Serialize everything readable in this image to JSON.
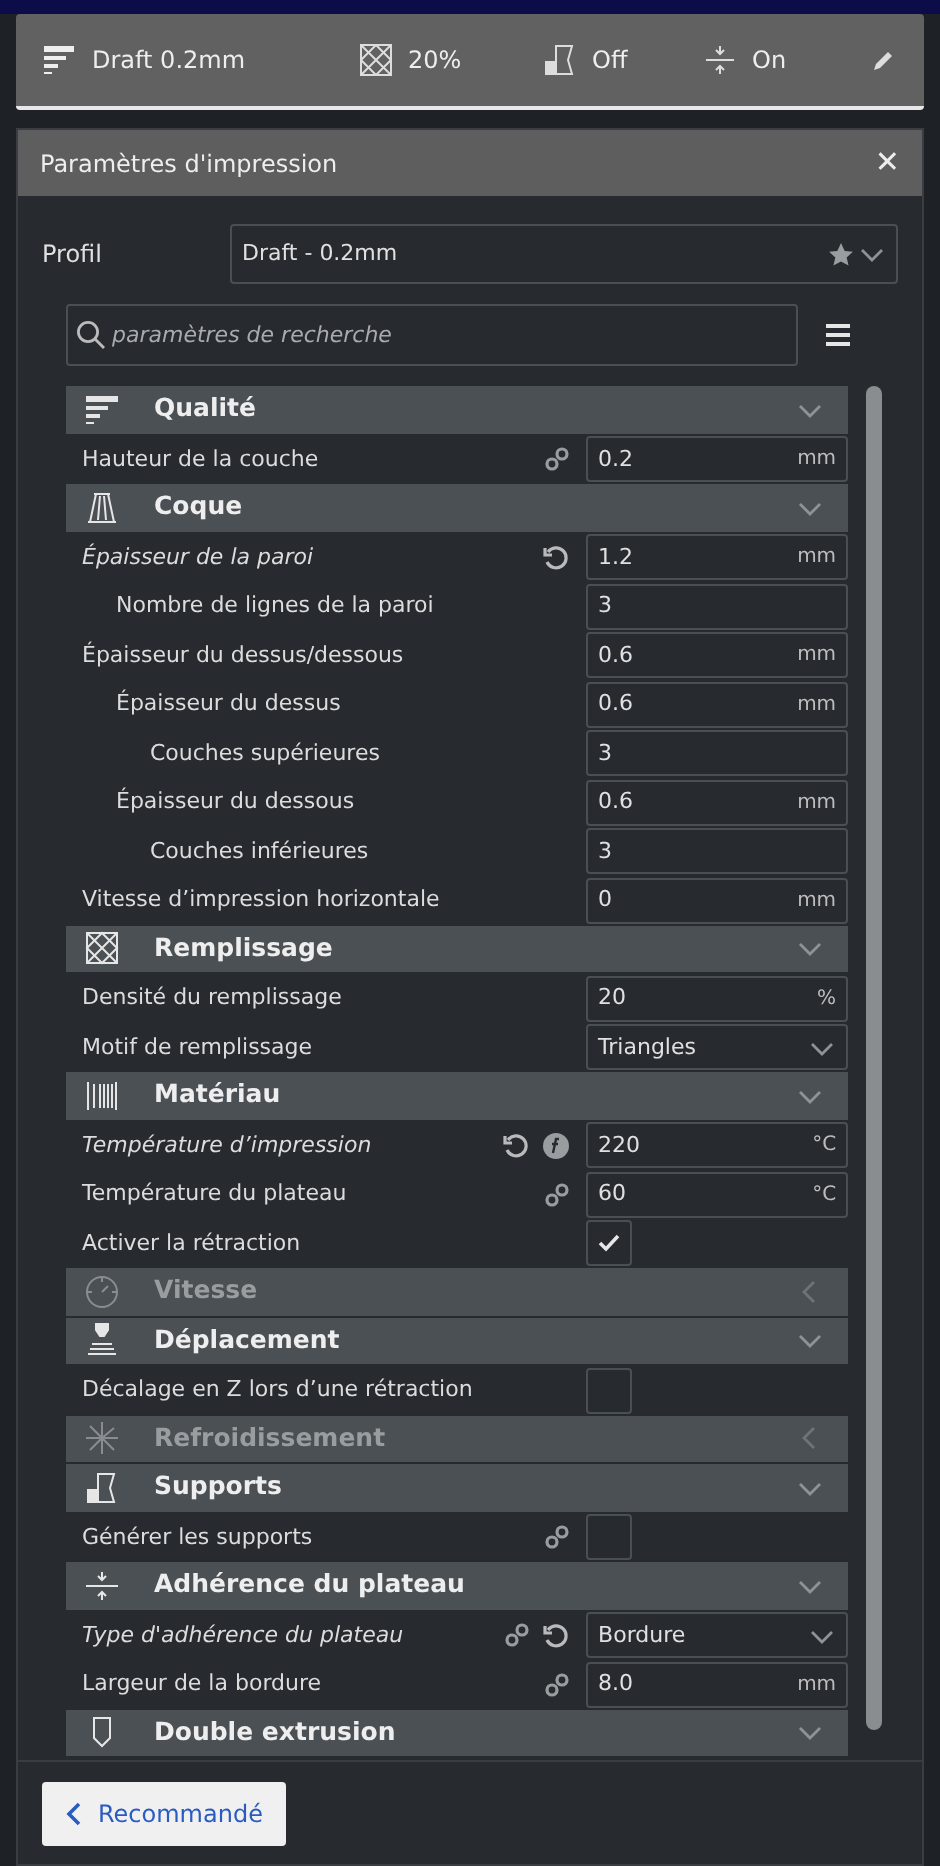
{
  "summary_bar": {
    "profile": "Draft 0.2mm",
    "infill": "20%",
    "support": "Off",
    "adhesion": "On"
  },
  "panel": {
    "title": "Paramètres d'impression",
    "close": "✕"
  },
  "profile": {
    "label": "Profil",
    "value": "Draft - 0.2mm"
  },
  "search": {
    "placeholder": "paramètres de recherche"
  },
  "sections": [
    {
      "kind": "quality",
      "title": "Qualité",
      "expanded": true,
      "settings": [
        {
          "label": "Hauteur de la couche",
          "kind": "number",
          "value": "0.2",
          "unit": "mm",
          "modified": false,
          "linked": true,
          "resettable": false,
          "formula": false
        }
      ]
    },
    {
      "kind": "shell",
      "title": "Coque",
      "expanded": true,
      "settings": [
        {
          "label": "Épaisseur de la paroi",
          "kind": "number",
          "value": "1.2",
          "unit": "mm",
          "modified": true,
          "linked": false,
          "resettable": true,
          "formula": false,
          "children": [
            {
              "label": "Nombre de lignes de la paroi",
              "kind": "number",
              "value": "3",
              "modified": false,
              "linked": false,
              "resettable": false,
              "formula": false
            }
          ]
        },
        {
          "label": "Épaisseur du dessus/dessous",
          "kind": "number",
          "value": "0.6",
          "unit": "mm",
          "modified": false,
          "linked": false,
          "resettable": false,
          "formula": false,
          "children": [
            {
              "label": "Épaisseur du dessus",
              "kind": "number",
              "value": "0.6",
              "unit": "mm",
              "modified": false,
              "linked": false,
              "resettable": false,
              "formula": false,
              "children": [
                {
                  "label": "Couches supérieures",
                  "kind": "number",
                  "value": "3",
                  "modified": false,
                  "linked": false,
                  "resettable": false,
                  "formula": false
                }
              ]
            },
            {
              "label": "Épaisseur du dessous",
              "kind": "number",
              "value": "0.6",
              "unit": "mm",
              "modified": false,
              "linked": false,
              "resettable": false,
              "formula": false,
              "children": [
                {
                  "label": "Couches inférieures",
                  "kind": "number",
                  "value": "3",
                  "modified": false,
                  "linked": false,
                  "resettable": false,
                  "formula": false
                }
              ]
            }
          ]
        },
        {
          "label": "Vitesse d’impression horizontale",
          "kind": "number",
          "value": "0",
          "unit": "mm",
          "modified": false,
          "linked": false,
          "resettable": false,
          "formula": false
        }
      ]
    },
    {
      "kind": "infill",
      "title": "Remplissage",
      "expanded": true,
      "settings": [
        {
          "label": "Densité du remplissage",
          "kind": "number",
          "value": "20",
          "unit": "%",
          "modified": false,
          "linked": false,
          "resettable": false,
          "formula": false
        },
        {
          "label": "Motif de remplissage",
          "kind": "select",
          "value": "Triangles",
          "modified": false,
          "linked": false,
          "resettable": false,
          "formula": false
        }
      ]
    },
    {
      "kind": "material",
      "title": "Matériau",
      "expanded": true,
      "settings": [
        {
          "label": "Température d’impression",
          "kind": "number",
          "value": "220",
          "unit": "°C",
          "modified": true,
          "linked": false,
          "resettable": true,
          "formula": true
        },
        {
          "label": "Température du plateau",
          "kind": "number",
          "value": "60",
          "unit": "°C",
          "modified": false,
          "linked": true,
          "resettable": false,
          "formula": false
        },
        {
          "label": "Activer la rétraction",
          "kind": "checkbox",
          "checked": true,
          "modified": false,
          "linked": false,
          "resettable": false,
          "formula": false
        }
      ]
    },
    {
      "kind": "speed",
      "title": "Vitesse",
      "expanded": false
    },
    {
      "kind": "travel",
      "title": "Déplacement",
      "expanded": true,
      "settings": [
        {
          "label": "Décalage en Z lors d’une rétraction",
          "kind": "checkbox",
          "checked": false,
          "modified": false,
          "linked": false,
          "resettable": false,
          "formula": false
        }
      ]
    },
    {
      "kind": "cooling",
      "title": "Refroidissement",
      "expanded": false
    },
    {
      "kind": "support",
      "title": "Supports",
      "expanded": true,
      "settings": [
        {
          "label": "Générer les supports",
          "kind": "checkbox",
          "checked": false,
          "modified": false,
          "linked": true,
          "resettable": false,
          "formula": false
        }
      ]
    },
    {
      "kind": "adhesion",
      "title": "Adhérence du plateau",
      "expanded": true,
      "settings": [
        {
          "label": "Type d'adhérence du plateau",
          "kind": "select",
          "value": "Bordure",
          "modified": true,
          "linked": true,
          "resettable": true,
          "formula": false
        },
        {
          "label": "Largeur de la bordure",
          "kind": "number",
          "value": "8.0",
          "unit": "mm",
          "modified": false,
          "linked": true,
          "resettable": false,
          "formula": false
        }
      ]
    },
    {
      "kind": "dual",
      "title": "Double extrusion",
      "expanded": true
    }
  ],
  "footer": {
    "button": "Recommandé"
  }
}
